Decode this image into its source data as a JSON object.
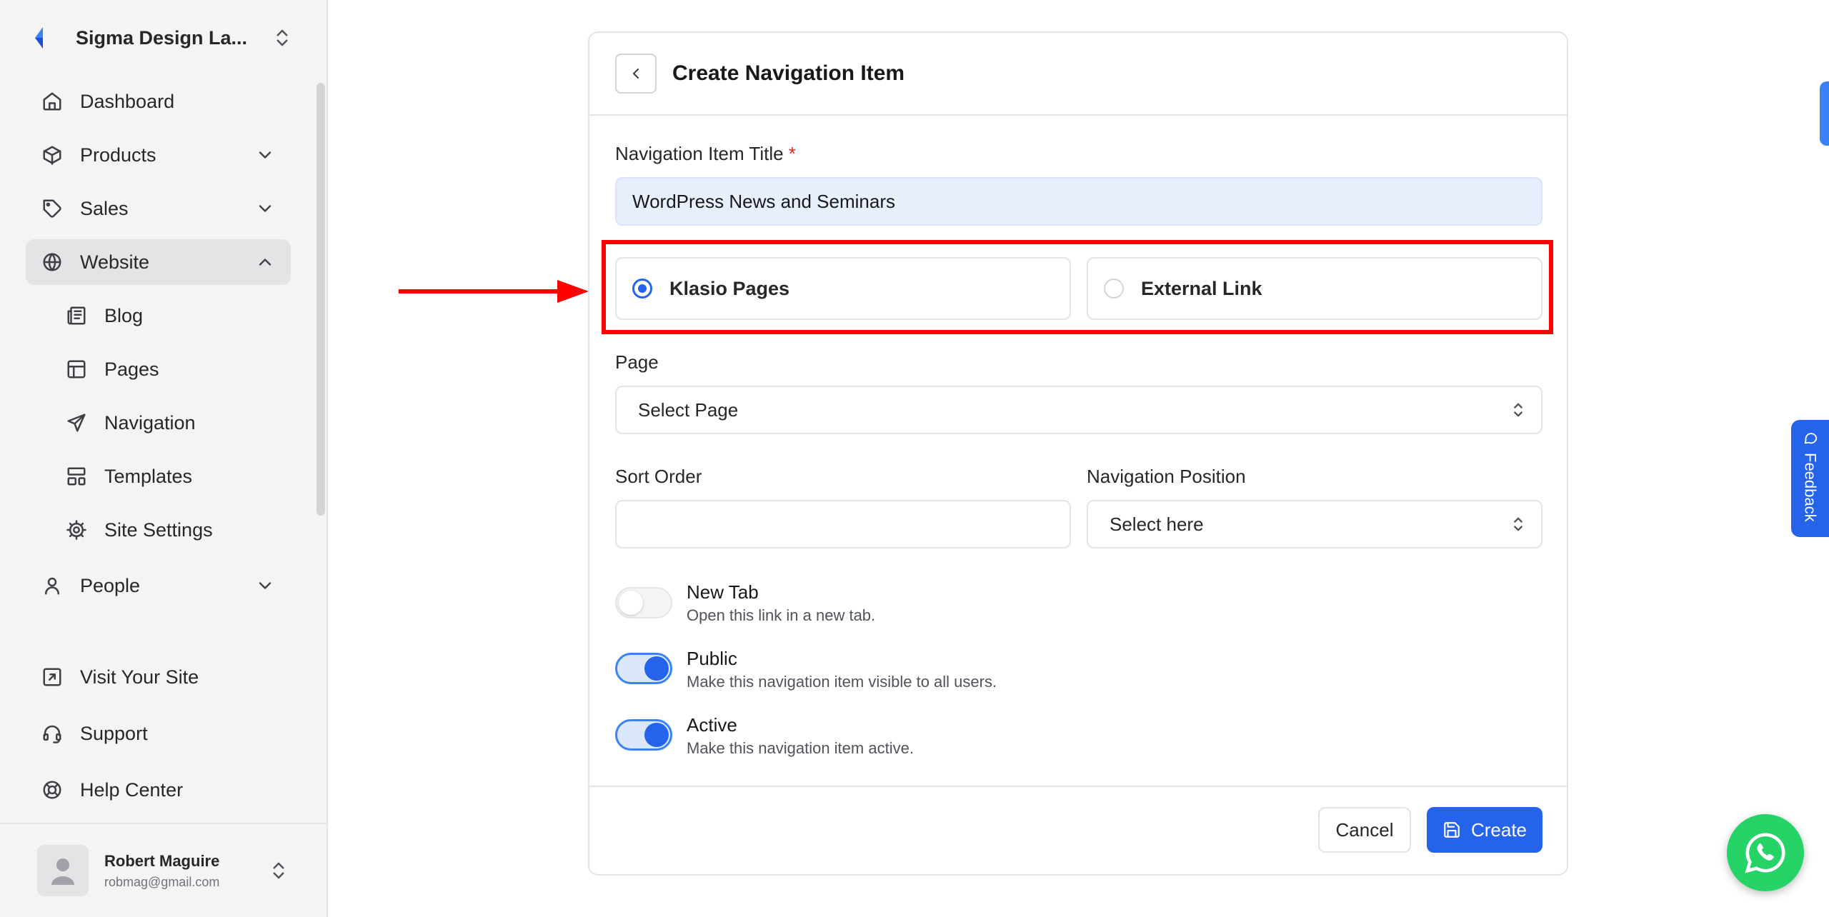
{
  "sidebar": {
    "org_name": "Sigma Design La...",
    "nav": [
      {
        "label": "Dashboard",
        "icon": "home-icon"
      },
      {
        "label": "Products",
        "icon": "box-icon"
      },
      {
        "label": "Sales",
        "icon": "tag-icon"
      },
      {
        "label": "Website",
        "icon": "globe-icon"
      },
      {
        "label": "Blog",
        "icon": "newspaper-icon"
      },
      {
        "label": "Pages",
        "icon": "layout-icon"
      },
      {
        "label": "Navigation",
        "icon": "send-icon"
      },
      {
        "label": "Templates",
        "icon": "template-icon"
      },
      {
        "label": "Site Settings",
        "icon": "cog-icon"
      },
      {
        "label": "People",
        "icon": "user-icon"
      }
    ],
    "bottom": [
      {
        "label": "Visit Your Site",
        "icon": "external-link-icon"
      },
      {
        "label": "Support",
        "icon": "headset-icon"
      },
      {
        "label": "Help Center",
        "icon": "lifebuoy-icon"
      }
    ],
    "user": {
      "name": "Robert Maguire",
      "email": "robmag@gmail.com"
    }
  },
  "form": {
    "title": "Create Navigation Item",
    "title_field": {
      "label": "Navigation Item Title",
      "required_mark": "*",
      "value": "WordPress News and Seminars"
    },
    "link_type": {
      "options": [
        "Klasio Pages",
        "External Link"
      ],
      "selected": "Klasio Pages"
    },
    "page": {
      "label": "Page",
      "value": "Select Page"
    },
    "sort_order": {
      "label": "Sort Order",
      "value": ""
    },
    "position": {
      "label": "Navigation Position",
      "value": "Select here"
    },
    "toggles": [
      {
        "title": "New Tab",
        "description": "Open this link in a new tab.",
        "on": false
      },
      {
        "title": "Public",
        "description": "Make this navigation item visible to all users.",
        "on": true
      },
      {
        "title": "Active",
        "description": "Make this navigation item active.",
        "on": true
      }
    ],
    "cancel_label": "Cancel",
    "create_label": "Create"
  },
  "feedback_label": "Feedback",
  "colors": {
    "primary": "#2563eb",
    "highlight": "#ff0000",
    "whatsapp": "#25d366"
  }
}
